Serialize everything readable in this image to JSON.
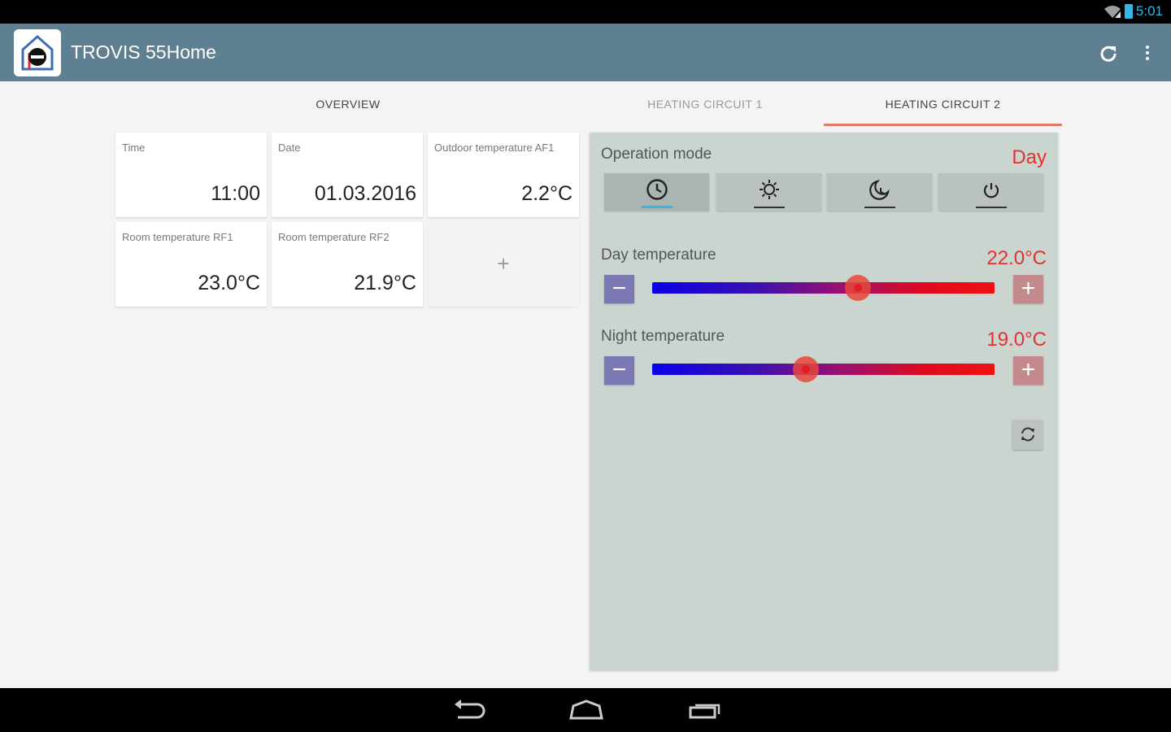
{
  "status_bar": {
    "time": "5:01"
  },
  "app_bar": {
    "title": "TROVIS 55Home"
  },
  "tabs": [
    {
      "label": "OVERVIEW",
      "active": false
    },
    {
      "label": "HEATING CIRCUIT 1",
      "active": false
    },
    {
      "label": "HEATING CIRCUIT 2",
      "active": true
    }
  ],
  "cards": [
    {
      "label": "Time",
      "value": "11:00"
    },
    {
      "label": "Date",
      "value": "01.03.2016"
    },
    {
      "label": "Outdoor temperature AF1",
      "value": "2.2°C"
    },
    {
      "label": "Room temperature RF1",
      "value": "23.0°C"
    },
    {
      "label": "Room temperature RF2",
      "value": "21.9°C"
    },
    {
      "label": "",
      "value": "+"
    }
  ],
  "panel": {
    "operation_mode_label": "Operation mode",
    "operation_mode_value": "Day",
    "modes": [
      {
        "icon": "clock-icon",
        "active": true
      },
      {
        "icon": "sun-icon",
        "active": false
      },
      {
        "icon": "moon-icon",
        "active": false
      },
      {
        "icon": "power-icon",
        "active": false
      }
    ],
    "day_temperature": {
      "label": "Day temperature",
      "value": "22.0°C",
      "level": 0.6
    },
    "night_temperature": {
      "label": "Night temperature",
      "value": "19.0°C",
      "level": 0.45
    },
    "minus": "−",
    "plus": "+"
  },
  "colors": {
    "app_bar": "#5f7f92",
    "accent": "#e53030",
    "tab_indicator": "#e57a6b",
    "panel": "#cbd5d0"
  }
}
